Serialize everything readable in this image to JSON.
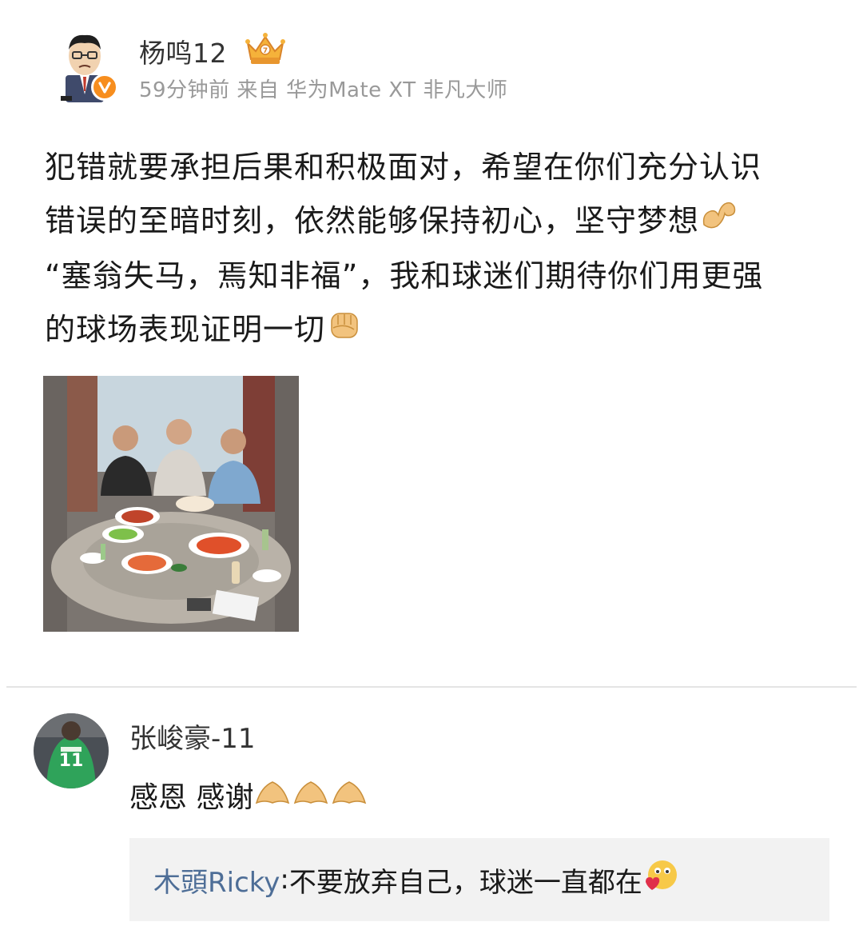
{
  "post": {
    "username": "杨鸣12",
    "meta": "59分钟前  来自 华为Mate XT 非凡大师",
    "text_lines": [
      "犯错就要承担后果和积极面对，希望在你们充分认识",
      "错误的至暗时刻，依然能够保持初心，坚守梦想",
      "“塞翁失马，焉知非福”，我和球迷们期待你们用更强",
      "的球场表现证明一切"
    ],
    "emojis": {
      "line2_end": "flexed-biceps",
      "line4_end": "raised-fist"
    },
    "badges": {
      "member_crown": "crown-icon",
      "verified": "verified-v-icon"
    }
  },
  "comment": {
    "username": "张峻豪-11",
    "text": "感恩 感谢",
    "emojis": [
      "pinched-fingers",
      "pinched-fingers",
      "pinched-fingers"
    ],
    "reply": {
      "user": "木頭Ricky",
      "separator": ":",
      "text": "不要放弃自己，球迷一直都在",
      "emoji": "love-face"
    }
  },
  "colors": {
    "text": "#1a1a1a",
    "meta": "#999999",
    "link_user": "#4e6e97",
    "verified_badge": "#f78e1e",
    "reply_bg": "#f2f2f2",
    "divider": "#e4e4e4"
  }
}
